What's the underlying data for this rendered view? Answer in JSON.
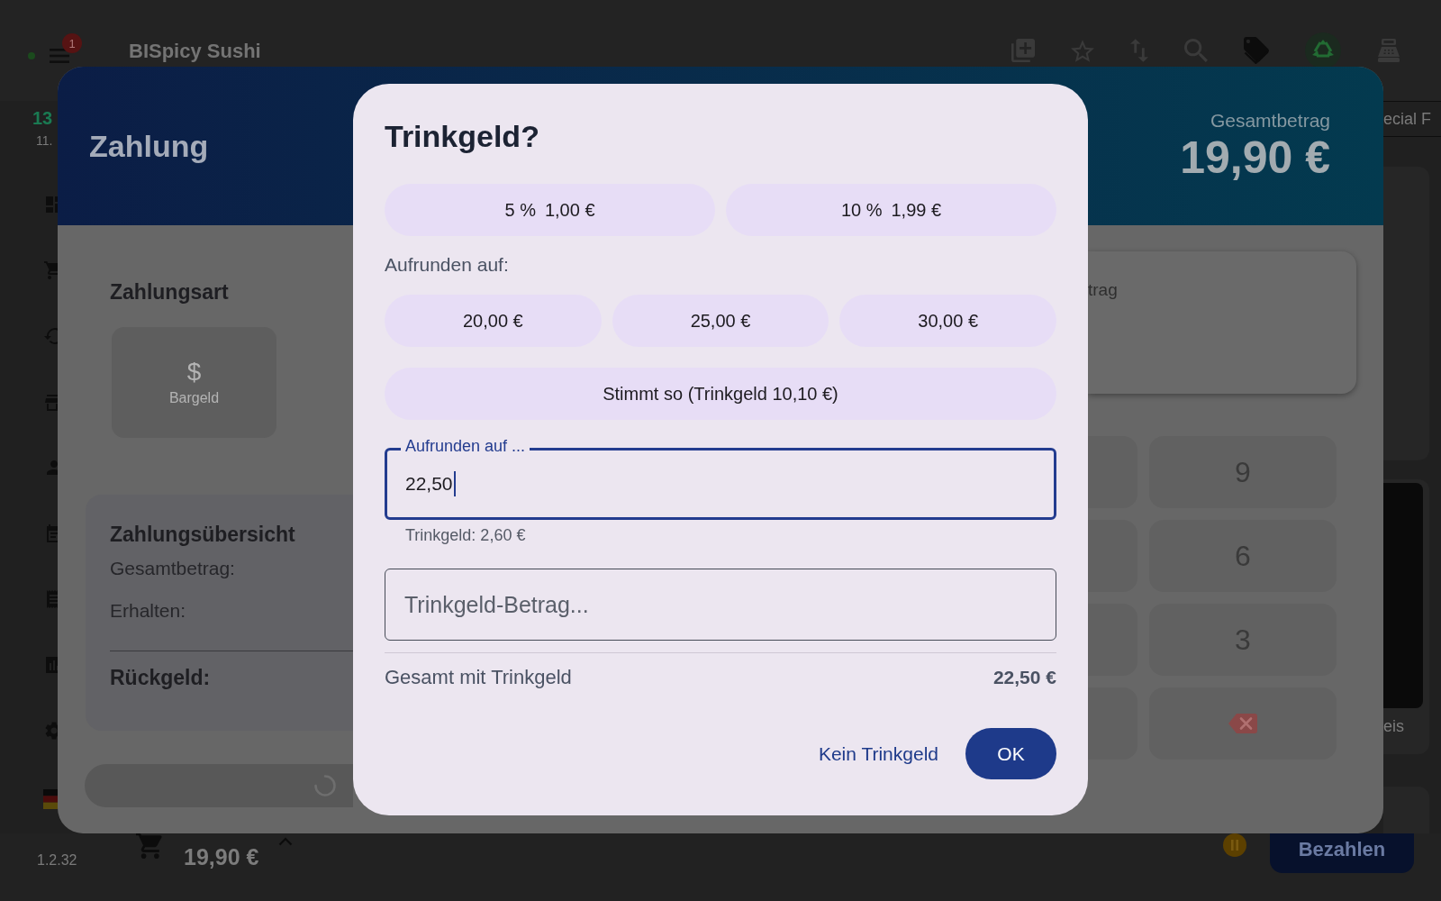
{
  "app_bar": {
    "notification_count": "1",
    "title": "BISpicy Sushi"
  },
  "sidebar": {
    "time": "13",
    "date": "11.",
    "version": "1.2.32"
  },
  "category_tab": {
    "label": "ecial F"
  },
  "product_label": "eis",
  "payment_dialog": {
    "title": "Zahlung",
    "total_label": "Gesamtbetrag",
    "total": "19,90 €",
    "method_heading": "Zahlungsart",
    "methods": [
      {
        "icon": "$",
        "label": "Bargeld"
      }
    ],
    "summary": {
      "heading": "Zahlungsübersicht",
      "rows": [
        "Gesamtbetrag:",
        "Erhalten:"
      ],
      "change_label": "Rückgeld:"
    },
    "amount_card_label": "trag",
    "keypad": [
      {
        "kind": "digit",
        "label": "9"
      },
      {
        "kind": "digit",
        "label": "6"
      },
      {
        "kind": "digit",
        "label": "3"
      },
      {
        "kind": "backspace"
      }
    ]
  },
  "tip_dialog": {
    "title": "Trinkgeld?",
    "percent_options": [
      {
        "percent": "5 %",
        "amount": "1,00 €"
      },
      {
        "percent": "10 %",
        "amount": "1,99 €"
      }
    ],
    "round_up_label": "Aufrunden auf:",
    "round_up_options": [
      "20,00 €",
      "25,00 €",
      "30,00 €"
    ],
    "exact_option": "Stimmt so (Trinkgeld 10,10 €)",
    "round_up_field": {
      "label": "Aufrunden auf ...",
      "value": "22,50",
      "focused": true,
      "helper": "Trinkgeld: 2,60 €"
    },
    "amount_field": {
      "placeholder": "Trinkgeld-Betrag..."
    },
    "total_label": "Gesamt mit Trinkgeld",
    "total": "22,50 €",
    "buttons": [
      {
        "label": "Kein Trinkgeld",
        "kind": "text"
      },
      {
        "label": "OK",
        "kind": "filled"
      }
    ]
  },
  "bottom_bar": {
    "cart_total": "19,90 €",
    "pay_button": "Bezahlen"
  }
}
